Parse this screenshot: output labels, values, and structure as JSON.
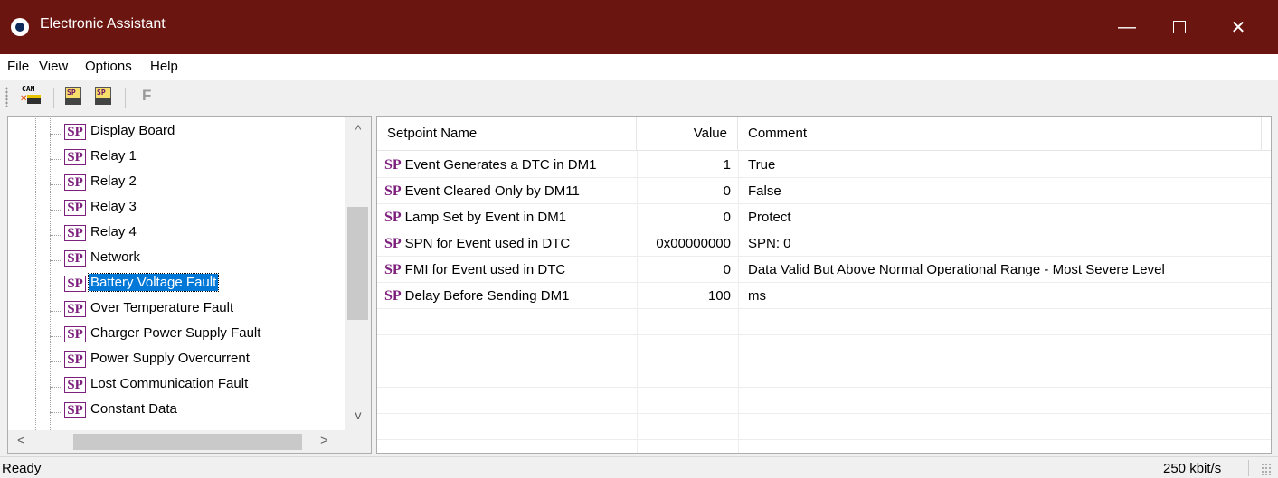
{
  "window": {
    "title": "Electronic Assistant",
    "minimize_glyph": "—",
    "close_glyph": "✕"
  },
  "menu": [
    "File",
    "View",
    "Options",
    "Help"
  ],
  "toolbar": {
    "can_label": "CAN",
    "sp_label": "SP",
    "f_label": "F"
  },
  "tree": {
    "icon_label": "SP",
    "items": [
      {
        "label": "Display Board"
      },
      {
        "label": "Relay 1"
      },
      {
        "label": "Relay 2"
      },
      {
        "label": "Relay 3"
      },
      {
        "label": "Relay 4"
      },
      {
        "label": "Network"
      },
      {
        "label": "Battery Voltage Fault",
        "selected": true
      },
      {
        "label": "Over Temperature Fault"
      },
      {
        "label": "Charger Power Supply Fault"
      },
      {
        "label": "Power Supply Overcurrent"
      },
      {
        "label": "Lost Communication Fault"
      },
      {
        "label": "Constant Data"
      }
    ],
    "scroll_up": "^",
    "scroll_down": "v",
    "scroll_left": "<",
    "scroll_right": ">"
  },
  "list": {
    "sp_mark": "SP",
    "columns": {
      "name": "Setpoint Name",
      "value": "Value",
      "comment": "Comment"
    },
    "rows": [
      {
        "name": "Event Generates a DTC in DM1",
        "value": "1",
        "comment": "True"
      },
      {
        "name": "Event Cleared Only by DM11",
        "value": "0",
        "comment": "False"
      },
      {
        "name": "Lamp Set by Event in DM1",
        "value": "0",
        "comment": "Protect"
      },
      {
        "name": "SPN for Event used in DTC",
        "value": "0x00000000",
        "comment": "SPN: 0"
      },
      {
        "name": "FMI for Event used in DTC",
        "value": "0",
        "comment": "Data Valid But Above Normal Operational Range - Most Severe Level"
      },
      {
        "name": "Delay Before Sending DM1",
        "value": "100",
        "comment": "ms"
      }
    ]
  },
  "status": {
    "left": "Ready",
    "right": "250 kbit/s"
  }
}
